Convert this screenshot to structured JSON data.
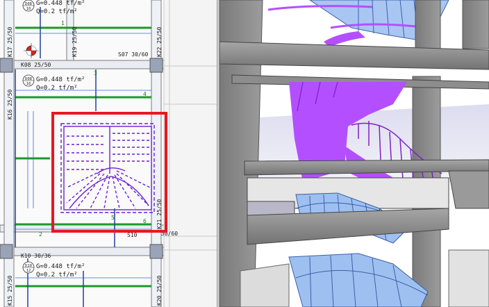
{
  "plan": {
    "load_labels": [
      {
        "id": "slab-d08-top",
        "code": "D08",
        "value": "10",
        "g": "G=0.448 tf/m²",
        "q": "Q=0.2 tf/m²"
      },
      {
        "id": "slab-d08-mid",
        "code": "D08",
        "value": "10",
        "g": "G=0.448 tf/m²",
        "q": "Q=0.2 tf/m²"
      },
      {
        "id": "slab-d10-bottom",
        "code": "D10",
        "value": "12",
        "g": "G=0.448 tf/m²",
        "q": "Q=0.2 tf/m²"
      }
    ],
    "beams": {
      "k08": "K08 25/50",
      "k10": "K10 30/36",
      "s07": "S07 30/60",
      "s10": "S10",
      "s10_dim": "30/60"
    },
    "columns": {
      "k17": "K17 25/50",
      "k19": "K19 25/50",
      "k22": "K22 25/50",
      "k16": "K16 25/50",
      "k21": "K21 25/50",
      "k15": "K15 25/50",
      "k20": "K20 25/50"
    },
    "axis_numbers": [
      "1",
      "2",
      "3",
      "4",
      "5",
      "6"
    ],
    "highlight_color": "#e8171f",
    "stair_color": "#6a1fd0"
  },
  "view3d": {
    "stair_color": "#b44fff",
    "lower_stair_color": "#9ec0f0",
    "concrete_color": "#8c8c8c"
  }
}
